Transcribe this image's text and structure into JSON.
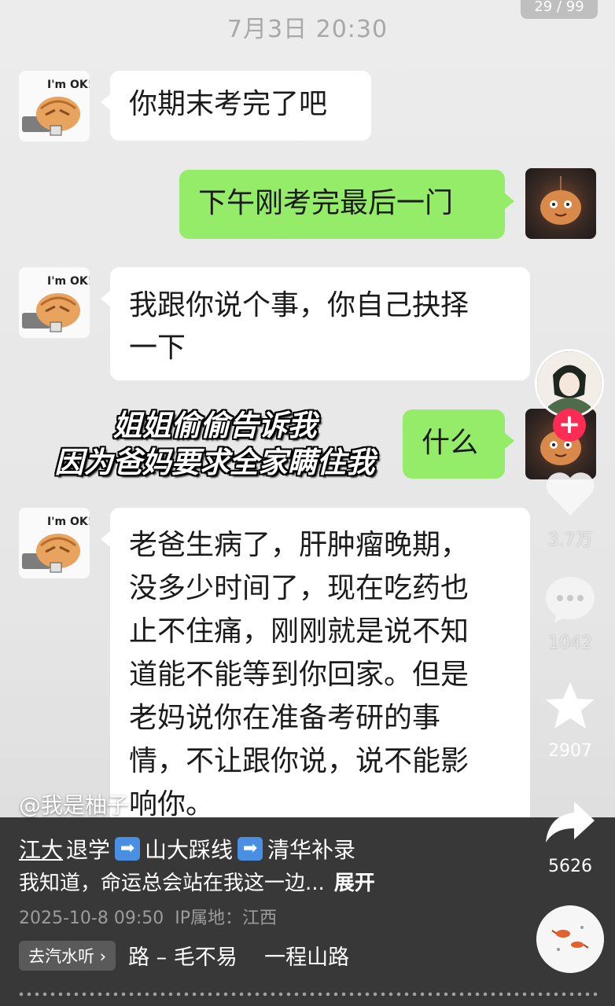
{
  "chat": {
    "timestamp": "7月3日 20:30",
    "page_counter": "29 / 99",
    "messages": [
      {
        "side": "left",
        "text": "你期末考完了吧"
      },
      {
        "side": "right",
        "text": "下午刚考完最后一门"
      },
      {
        "side": "left",
        "line1": "我跟你说个事，你自己抉择",
        "line2": "一下"
      },
      {
        "side": "right",
        "text": "什么"
      },
      {
        "side": "left",
        "lines": [
          "老爸生病了，肝肿瘤晚期，",
          "没多少时间了，现在吃药也",
          "止不住痛，刚刚就是说不知",
          "道能不能等到你回家。但是",
          "老妈说你在准备考研的事",
          "情，不让跟你说，说不能影",
          "响你。"
        ]
      }
    ],
    "left_avatar_text": "I'm OK!"
  },
  "caption": {
    "line1": "姐姐偷偷告诉我",
    "line2": "因为爸妈要求全家瞒住我"
  },
  "side_actions": {
    "likes": "3.7万",
    "comments": "1042",
    "favorites": "2907",
    "shares": "5626",
    "follow_symbol": "+"
  },
  "post": {
    "handle": "@我是柚子",
    "title_parts": [
      "江大",
      "退学",
      "山大踩线",
      "清华补录"
    ],
    "description": "我知道，命运总会站在我这一边...",
    "expand_label": "展开",
    "date": "2025-10-8 09:50",
    "ip_location": "IP属地：江西"
  },
  "music": {
    "tag": "去汽水听 ›",
    "title": "路 – 毛不易    一程山路"
  },
  "colors": {
    "sent_bubble": "#95ec69",
    "received_bubble": "#ffffff",
    "follow_button": "#fe2c55",
    "bottom_panel": "#383838"
  },
  "icons": [
    "heart-icon",
    "comment-icon",
    "star-icon",
    "share-icon",
    "music-disc-icon",
    "right-arrow-emoji-icon"
  ]
}
